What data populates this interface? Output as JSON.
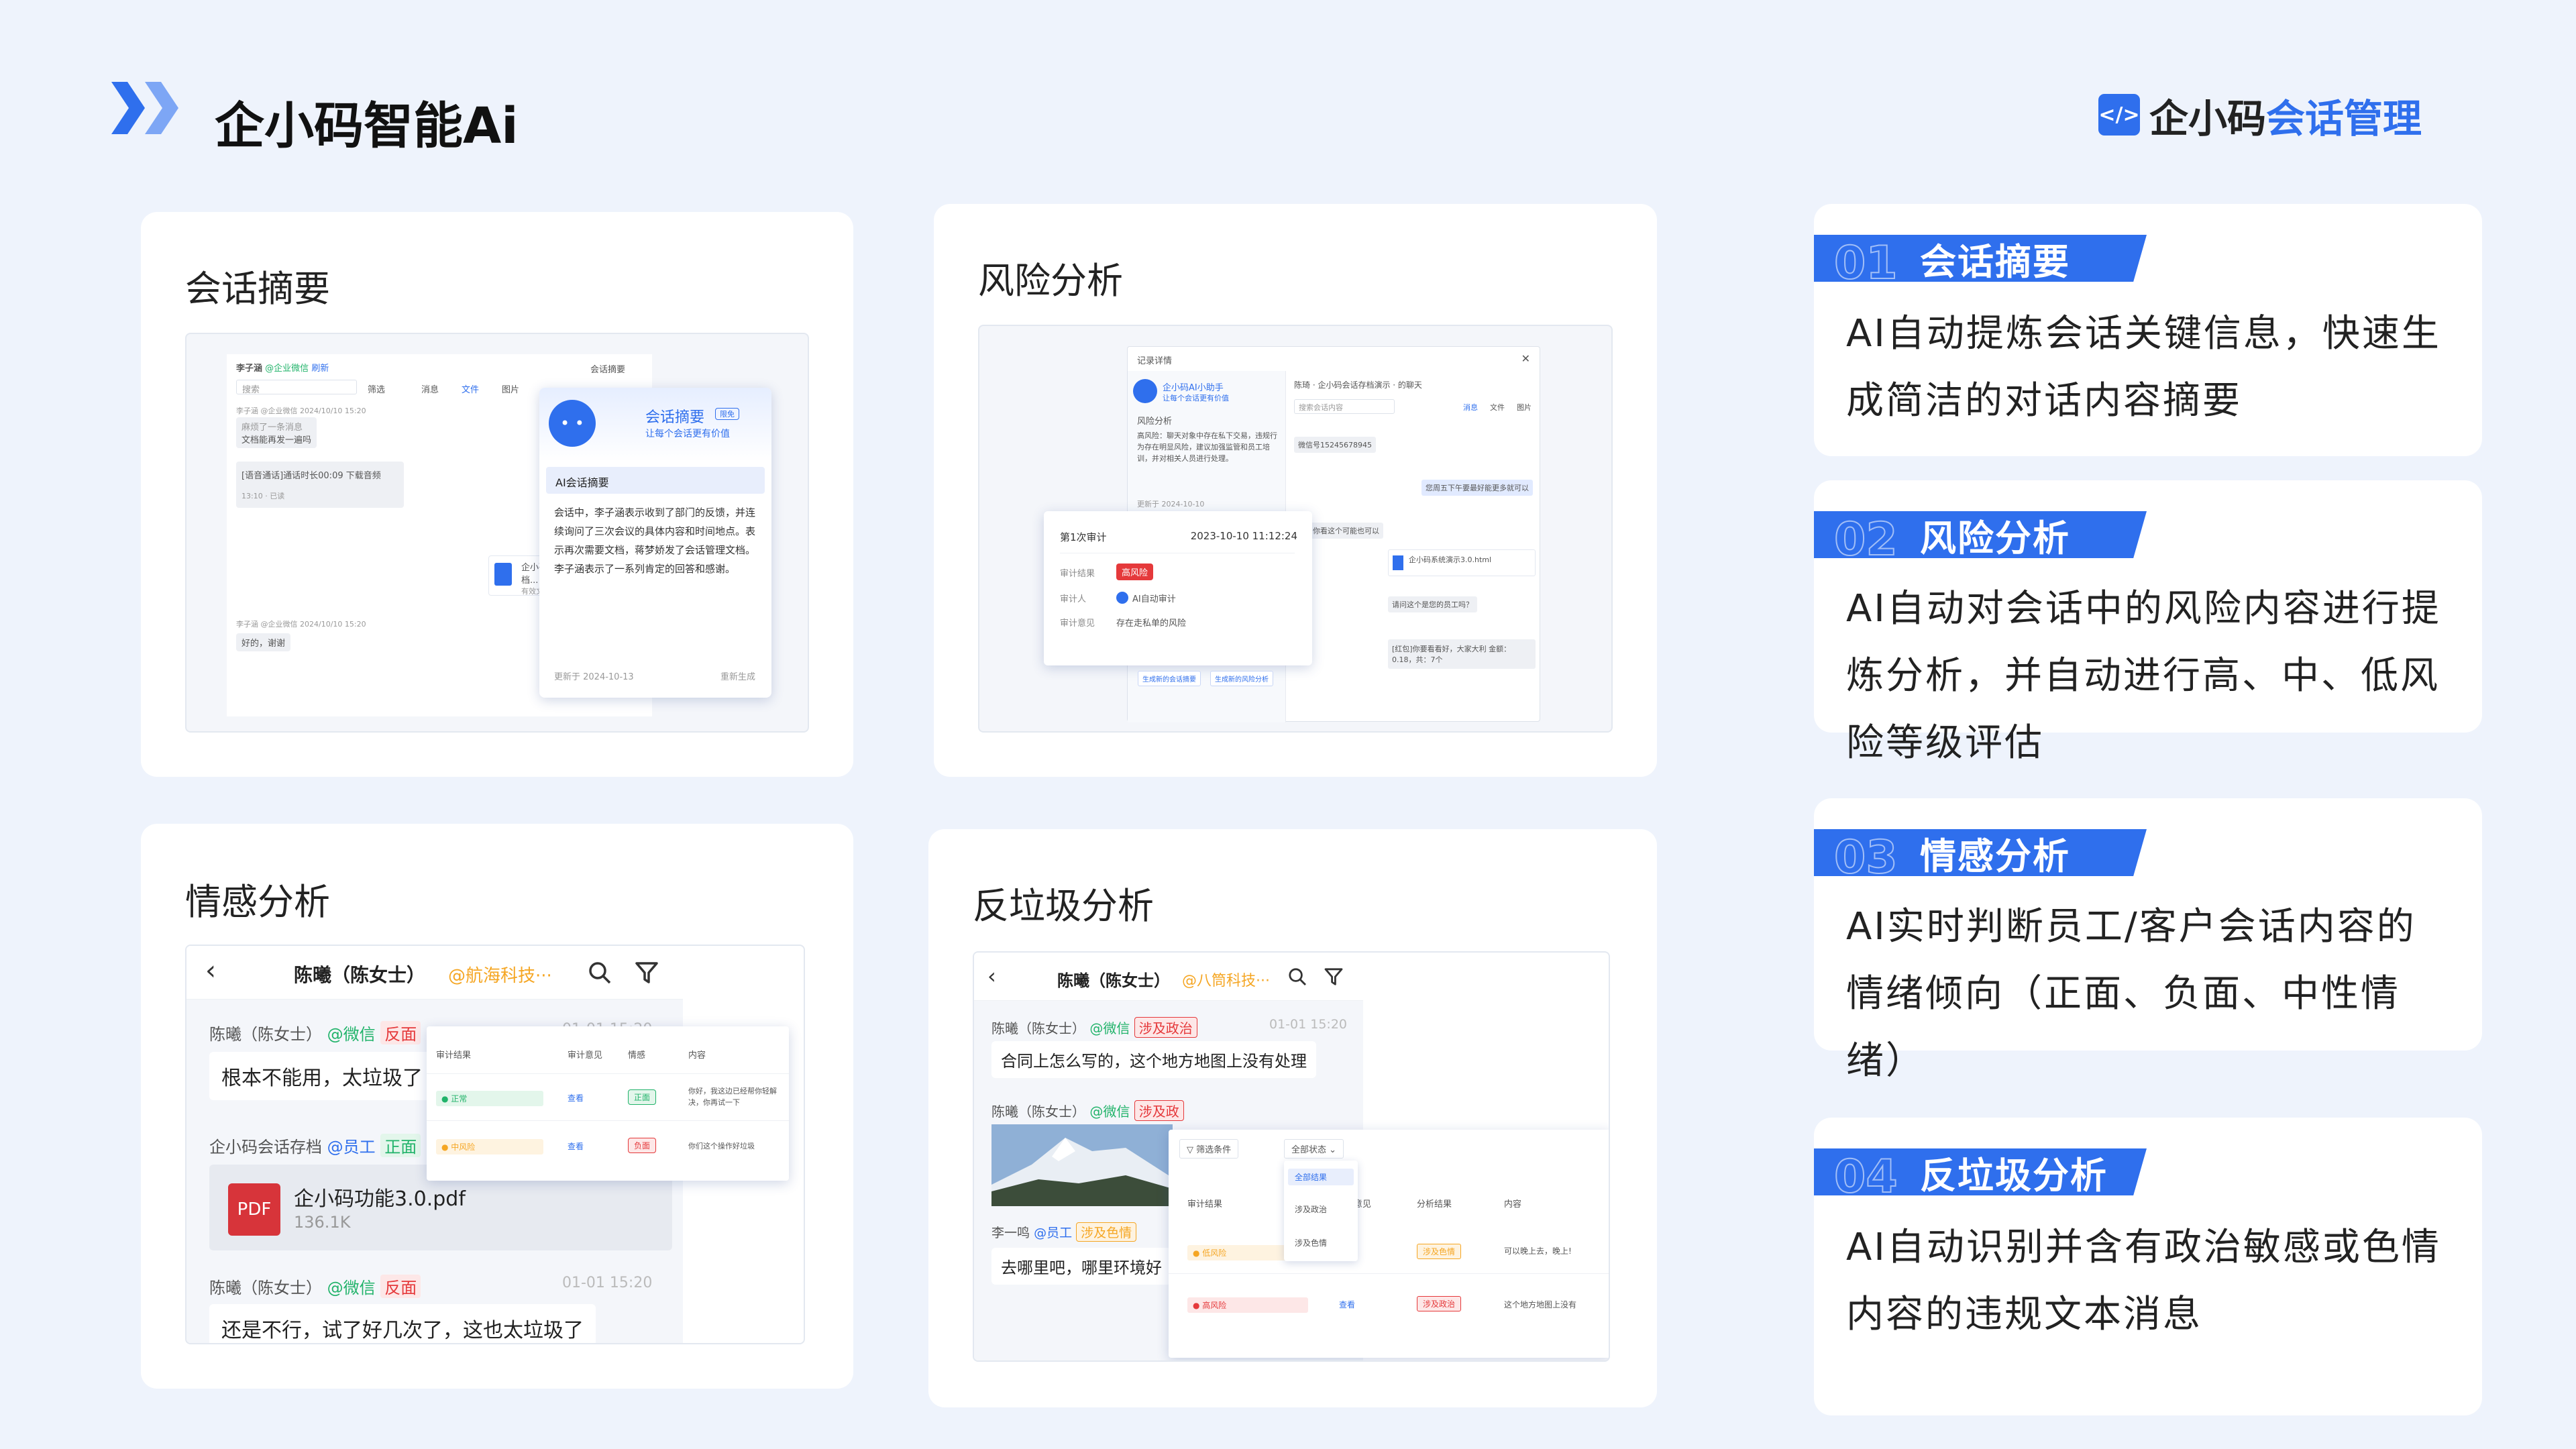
{
  "header": {
    "title": "企小码智能Ai",
    "logo_badge": "</>",
    "logo_brand": "企小码",
    "logo_product": "会话管理"
  },
  "cards": {
    "summary": {
      "title": "会话摘要"
    },
    "risk": {
      "title": "风险分析"
    },
    "emotion": {
      "title": "情感分析"
    },
    "spam": {
      "title": "反垃圾分析"
    }
  },
  "summary_shot": {
    "contact": "李子涵",
    "contact_tag": "@企业微信",
    "refresh": "刷新",
    "summary_btn": "会话摘要",
    "search": "搜索",
    "filter": "筛选",
    "tabs": [
      "消息",
      "文件",
      "图片"
    ],
    "msg1_meta": "李子涵 @企业微信 2024/10/10 15:20",
    "msg1": "麻烦了一条消息",
    "msg1b": "文档能再发一遍吗",
    "msg2": "[语音通话]通话时长00:09 下载音频",
    "msg2_meta": "13:10 · 已读",
    "file_name": "企小码会话内容存档...",
    "file_meta": "有效文件 · 已读",
    "msg3_meta": "李子涵 @企业微信 2024/10/10 15:20",
    "msg3": "好的，谢谢",
    "popup_title": "会话摘要",
    "popup_badge": "限免",
    "popup_sub": "让每个会话更有价值",
    "popup_section": "AI会话摘要",
    "popup_body": "会话中，李子涵表示收到了部门的反馈，并连续询问了三次会议的具体内容和时间地点。表示再次需要文档，蒋梦娇发了会话管理文档。李子涵表示了一系列肯定的回答和感谢。",
    "popup_updated": "更新于 2024-10-13",
    "popup_regen": "重新生成"
  },
  "risk_shot": {
    "window_title": "记录详情",
    "bot_name": "企小码AI小助手",
    "bot_sub": "让每个会话更有价值",
    "risk_label": "风险分析",
    "risk_text": "高风险：聊天对象中存在私下交易，违规行为存在明显风险，建议加强监管和员工培训，并对相关人员进行处理。",
    "updated": "更新于 2024-10-10",
    "chat_head": "陈琦 · 企小码会话存档演示 · 的聊天",
    "search": "搜索会话内容",
    "chat_tabs": [
      "消息",
      "文件",
      "图片"
    ],
    "chat_msg1": "微信号15245678945",
    "chat_msg2": "您周五下午要最好能更多就可以",
    "chat_msg3": "了，你看这个可能也可以",
    "file": "企小码系统演示3.0.html",
    "chat_msg4": "请问这个是您的员工吗？",
    "chat_msg5": "[红包]你要看看好，大家大利 金额：0.18，共：7个",
    "audit_title": "第1次审计",
    "audit_time": "2023-10-10 11:12:24",
    "audit_result_label": "审计结果",
    "audit_result": "高风险",
    "auditor_label": "审计人",
    "auditor": "AI自动审计",
    "opinion_label": "审计意见",
    "opinion": "存在走私单的风险",
    "btn1": "生成新的会话摘要",
    "btn2": "生成新的风险分析"
  },
  "emotion_shot": {
    "contact": "陈曦（陈女士）",
    "org": "@航海科技···",
    "m1_name": "陈曦（陈女士）",
    "m1_src": "@微信",
    "m1_tag": "反面",
    "m1_time": "01-01 15:20",
    "m1": "根本不能用，太垃圾了",
    "m2_name": "企小码会话存档",
    "m2_src": "@员工",
    "m2_tag": "正面",
    "file_icon": "PDF",
    "file_name": "企小码功能3.0.pdf",
    "file_size": "136.1K",
    "m3_name": "陈曦（陈女士）",
    "m3_src": "@微信",
    "m3_tag": "反面",
    "m3_time": "01-01 15:20",
    "m3": "还是不行，试了好几次了，这也太垃圾了",
    "table_headers": [
      "审计结果",
      "审计意见",
      "情感",
      "内容"
    ],
    "rows": [
      {
        "result": "正常",
        "opinion": "查看",
        "emotion": "正面",
        "content": "你好，我这边已经帮你轻解决，你再试一下"
      },
      {
        "result": "中风险",
        "opinion": "查看",
        "emotion": "负面",
        "content": "你们这个操作好垃圾"
      }
    ]
  },
  "spam_shot": {
    "contact": "陈曦（陈女士）",
    "org": "@八筒科技···",
    "m1_name": "陈曦（陈女士）",
    "m1_src": "@微信",
    "m1_tag": "涉及政治",
    "m1_time": "01-01 15:20",
    "m1": "合同上怎么写的，这个地方地图上没有处理",
    "m2_name": "陈曦（陈女士）",
    "m2_src": "@微信",
    "m2_tag": "涉及政",
    "m3_name": "李一鸣",
    "m3_src": "@员工",
    "m3_tag": "涉及色情",
    "m3": "去哪里吧，哪里环境好",
    "filter": "筛选条件",
    "status": "全部状态",
    "options": [
      "全部结果",
      "涉及政治",
      "涉及色情"
    ],
    "table_headers": [
      "审计结果",
      "审计意见",
      "分析结果",
      "内容"
    ],
    "rows": [
      {
        "result": "低风险",
        "opinion": "查看",
        "analysis": "涉及色情",
        "content": "可以晚上去，晚上!"
      },
      {
        "result": "高风险",
        "opinion": "查看",
        "analysis": "涉及政治",
        "content": "这个地方地图上没有"
      }
    ]
  },
  "features": [
    {
      "num": "01",
      "name": "会话摘要",
      "desc": [
        "AI自动提炼会话关键信息，快速生",
        "成简洁的对话内容摘要"
      ]
    },
    {
      "num": "02",
      "name": "风险分析",
      "desc": [
        "AI自动对会话中的风险内容进行提",
        "炼分析，并自动进行高、中、低风",
        "险等级评估"
      ]
    },
    {
      "num": "03",
      "name": "情感分析",
      "desc": [
        "AI实时判断员工/客户会话内容的",
        "情绪倾向（正面、负面、中性情",
        "绪）"
      ]
    },
    {
      "num": "04",
      "name": "反垃圾分析",
      "desc": [
        "AI自动识别并含有政治敏感或色情",
        "内容的违规文本消息"
      ]
    }
  ],
  "colors": {
    "brand": "#2f6fed",
    "danger": "#e5393b",
    "warn": "#f5a623",
    "success": "#21b36a",
    "page_bg": "#eef3fc"
  }
}
